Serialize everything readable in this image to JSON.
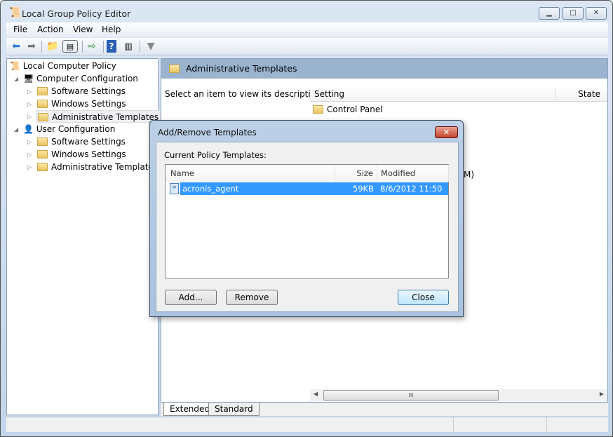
{
  "window": {
    "title": "Local Group Policy Editor",
    "minimize": "▁",
    "maximize": "□",
    "close": "✕"
  },
  "menu": [
    "File",
    "Action",
    "View",
    "Help"
  ],
  "tree": {
    "root": "Local Computer Policy",
    "computer": {
      "label": "Computer Configuration",
      "children": [
        "Software Settings",
        "Windows Settings",
        "Administrative Templates"
      ]
    },
    "user": {
      "label": "User Configuration",
      "children": [
        "Software Settings",
        "Windows Settings",
        "Administrative Templates"
      ]
    }
  },
  "right": {
    "header": "Administrative Templates",
    "description": "Select an item to view its description.",
    "columns": [
      "Setting",
      "State"
    ],
    "rows": [
      "Control Panel"
    ],
    "occluded_text": "M)",
    "scroll_grip": "III"
  },
  "tabs": [
    "Extended",
    "Standard"
  ],
  "dialog": {
    "title": "Add/Remove Templates",
    "close": "✕",
    "label": "Current Policy Templates:",
    "columns": [
      "Name",
      "Size",
      "Modified"
    ],
    "rows": [
      {
        "name": "acronis_agent",
        "size": "59KB",
        "modified": "8/6/2012 11:50 ..."
      }
    ],
    "buttons": {
      "add": "Add...",
      "remove": "Remove",
      "close": "Close"
    }
  }
}
